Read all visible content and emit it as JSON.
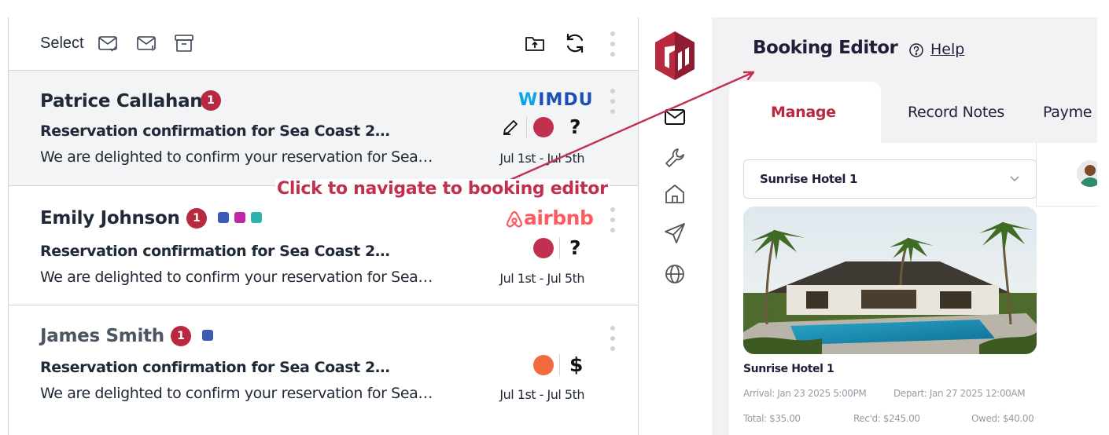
{
  "inbox": {
    "toolbar": {
      "select_label": "Select",
      "icons": [
        "mail-check-icon",
        "mail-alert-icon",
        "archive-icon",
        "folder-upload-icon",
        "refresh-icon",
        "more-vertical-icon"
      ]
    },
    "messages": [
      {
        "sender": "Patrice Callahan",
        "badge": "1",
        "tags": [],
        "channel": "WIMDU",
        "subject": "Reservation confirmation for Sea Coast 2…",
        "preview": "We are delighted to confirm your reservation for Sea…",
        "dates": "Jul 1st - Jul 5th",
        "status_color": "#c2304f",
        "status_glyph": "?",
        "icons": [
          "pencil-icon",
          "more-vertical-icon"
        ]
      },
      {
        "sender": "Emily Johnson",
        "badge": "1",
        "tags": [
          "#3b5bb5",
          "#c026a8",
          "#2bb3ad"
        ],
        "channel": "airbnb",
        "subject": "Reservation confirmation for Sea Coast 2…",
        "preview": "We are delighted to confirm your reservation for Sea…",
        "dates": "Jul 1st - Jul 5th",
        "status_color": "#c2304f",
        "status_glyph": "?",
        "icons": [
          "airbnb-logo-icon",
          "more-vertical-icon"
        ]
      },
      {
        "sender": "James Smith",
        "badge": "1",
        "tags": [
          "#3b5bb5"
        ],
        "channel": "",
        "subject": "Reservation confirmation for Sea Coast 2…",
        "preview": "We are delighted to confirm your reservation for Sea…",
        "dates": "Jul 1st - Jul 5th",
        "status_color": "#f26a3d",
        "status_glyph": "$",
        "icons": [
          "more-vertical-icon"
        ]
      }
    ]
  },
  "annotation": {
    "text": "Click to navigate to booking editor",
    "color": "#c2304f"
  },
  "rail": {
    "logo": "brand-logo-icon",
    "items": [
      "mail-icon",
      "wrench-icon",
      "home-icon",
      "send-icon",
      "globe-icon"
    ],
    "brand_color": "#b8283f"
  },
  "editor": {
    "title": "Booking Editor",
    "help_label": "Help",
    "tabs": [
      "Manage",
      "Record Notes",
      "Payme"
    ],
    "active_tab": "Manage",
    "property_select": "Sunrise Hotel 1",
    "hotel_name": "Sunrise Hotel 1",
    "arrival": "Arrival: Jan 23 2025 5:00PM",
    "depart": "Depart: Jan 27 2025 12:00AM",
    "total": "Total: $35.00",
    "received": "Rec'd: $245.00",
    "owed": "Owed: $40.00"
  }
}
